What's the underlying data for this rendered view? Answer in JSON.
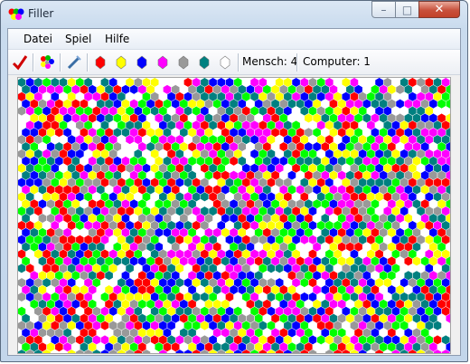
{
  "window": {
    "title": "Filler",
    "controls": {
      "minimize": "–",
      "maximize": "□",
      "close": "✕"
    }
  },
  "menu": [
    "Datei",
    "Spiel",
    "Hilfe"
  ],
  "toolbar": {
    "new_game_icon": "check-icon",
    "palette_icon": "palette-icon",
    "settings_icon": "wand-icon",
    "colors": [
      {
        "name": "red",
        "hex": "#ff0000"
      },
      {
        "name": "yellow",
        "hex": "#ffff00"
      },
      {
        "name": "blue",
        "hex": "#0000ff"
      },
      {
        "name": "magenta",
        "hex": "#ff00ff"
      },
      {
        "name": "gray",
        "hex": "#999999"
      },
      {
        "name": "teal",
        "hex": "#008080"
      },
      {
        "name": "white",
        "hex": "#ffffff"
      }
    ],
    "human_score": "Mensch: 4",
    "computer_score": "Computer: 1"
  },
  "board": {
    "palette": [
      "#ff0000",
      "#ffff00",
      "#0000ff",
      "#ff00ff",
      "#999999",
      "#008080",
      "#ffffff",
      "#00ff00"
    ],
    "cols": 52,
    "rows": 39
  }
}
